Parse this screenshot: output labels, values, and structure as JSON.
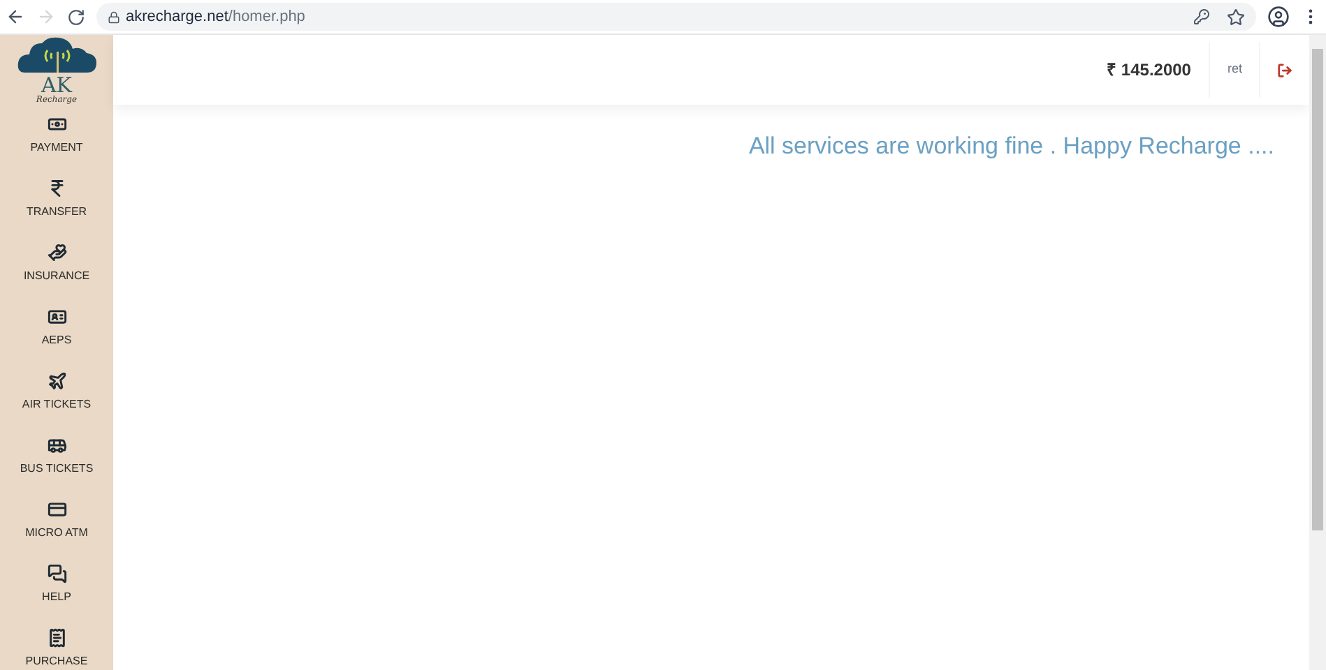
{
  "browser": {
    "url_host": "akrecharge.net",
    "url_path": "/homer.php"
  },
  "logo": {
    "letters": "AK",
    "tagline": "Recharge"
  },
  "sidebar": {
    "items": [
      {
        "label": "PAYMENT"
      },
      {
        "label": "TRANSFER"
      },
      {
        "label": "INSURANCE"
      },
      {
        "label": "AEPS"
      },
      {
        "label": "AIR TICKETS"
      },
      {
        "label": "BUS TICKETS"
      },
      {
        "label": "MICRO ATM"
      },
      {
        "label": "HELP"
      },
      {
        "label": "PURCHASE"
      }
    ]
  },
  "header": {
    "balance": "₹ 145.2000",
    "user": "ret"
  },
  "notice": "All services are working fine . Happy Recharge ...."
}
